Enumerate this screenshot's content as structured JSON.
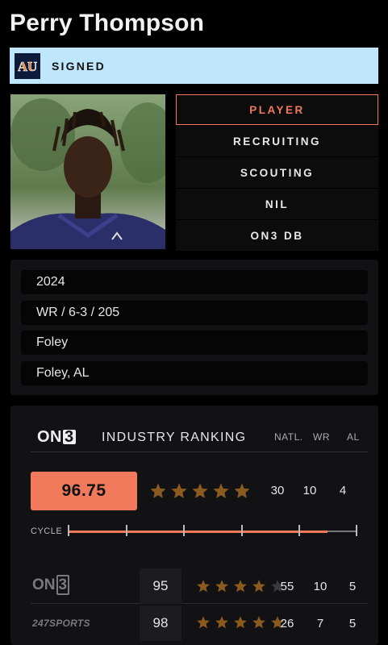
{
  "player": {
    "name": "Perry Thompson"
  },
  "status": {
    "label": "SIGNED",
    "logo_icon": "auburn-logo-icon"
  },
  "nav": {
    "items": [
      {
        "label": "PLAYER",
        "active": true
      },
      {
        "label": "RECRUITING"
      },
      {
        "label": "SCOUTING"
      },
      {
        "label": "NIL"
      },
      {
        "label": "ON3 DB"
      }
    ]
  },
  "info": {
    "class_year": "2024",
    "position_size": "WR / 6-3 / 205",
    "high_school": "Foley",
    "hometown": "Foley, AL"
  },
  "ranking": {
    "brand": "ON",
    "brand_mark": "3",
    "title": "INDUSTRY RANKING",
    "columns": {
      "natl": "NATL.",
      "pos": "WR",
      "state": "AL"
    },
    "industry": {
      "score": "96.75",
      "stars": 5,
      "natl": "30",
      "pos": "10",
      "state": "4"
    },
    "cycle_label": "CYCLE",
    "cycle_progress": 0.9,
    "sources": [
      {
        "name": "ON3",
        "brand": "ON",
        "brand_mark": "3",
        "score": "95",
        "stars": 4,
        "natl": "55",
        "pos": "10",
        "state": "5"
      },
      {
        "name": "247SPORTS",
        "score": "98",
        "stars": 5,
        "natl": "26",
        "pos": "7",
        "state": "5"
      }
    ]
  },
  "colors": {
    "accent": "#f27a5c",
    "star": "#8a5a1e",
    "star_empty": "#3a3a3a",
    "status_bg": "#bfe6fb"
  }
}
